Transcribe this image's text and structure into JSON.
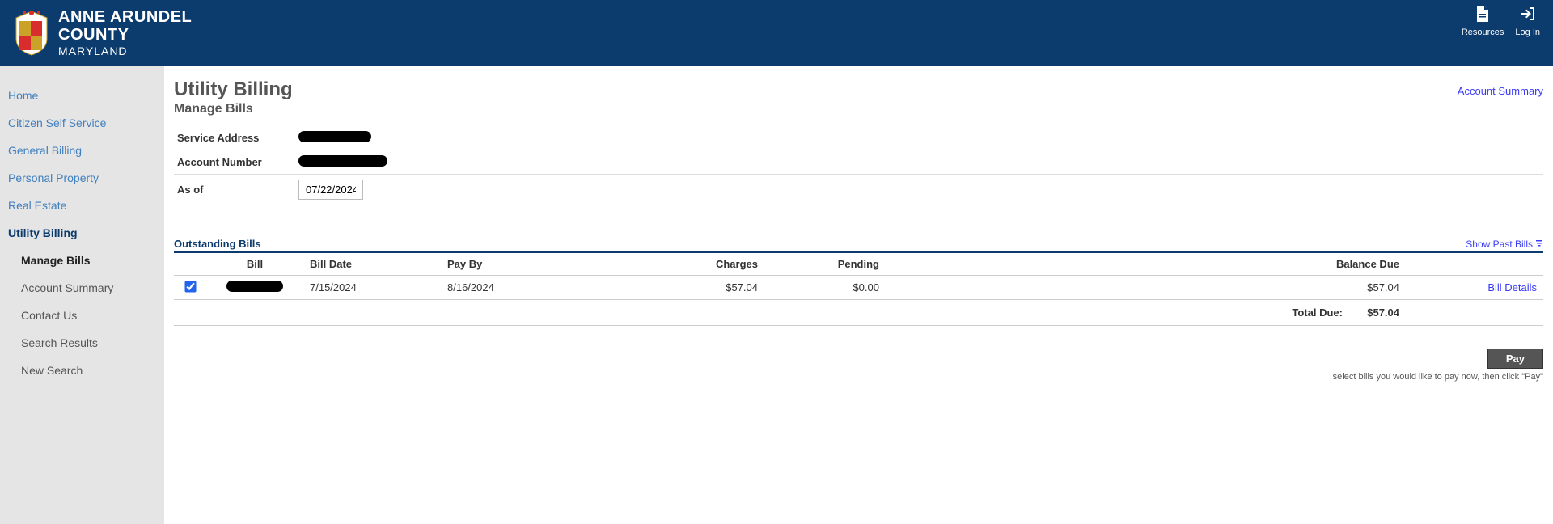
{
  "header": {
    "org_line1": "ANNE ARUNDEL",
    "org_line2": "COUNTY",
    "org_line3": "MARYLAND",
    "actions": {
      "resources": "Resources",
      "login": "Log In"
    }
  },
  "sidebar": {
    "items": [
      {
        "label": "Home"
      },
      {
        "label": "Citizen Self Service"
      },
      {
        "label": "General Billing"
      },
      {
        "label": "Personal Property"
      },
      {
        "label": "Real Estate"
      },
      {
        "label": "Utility Billing"
      }
    ],
    "subitems": [
      {
        "label": "Manage Bills"
      },
      {
        "label": "Account Summary"
      },
      {
        "label": "Contact Us"
      },
      {
        "label": "Search Results"
      },
      {
        "label": "New Search"
      }
    ]
  },
  "main": {
    "title": "Utility Billing",
    "subtitle": "Manage Bills",
    "account_summary_link": "Account Summary",
    "fields": {
      "service_address_label": "Service Address",
      "account_number_label": "Account Number",
      "as_of_label": "As of",
      "as_of_value": "07/22/2024"
    },
    "outstanding": {
      "title": "Outstanding Bills",
      "show_past": "Show Past Bills",
      "columns": {
        "bill": "Bill",
        "bill_date": "Bill Date",
        "pay_by": "Pay By",
        "charges": "Charges",
        "pending": "Pending",
        "balance_due": "Balance Due"
      },
      "rows": [
        {
          "checked": true,
          "bill_date": "7/15/2024",
          "pay_by": "8/16/2024",
          "charges": "$57.04",
          "pending": "$0.00",
          "balance_due": "$57.04",
          "details": "Bill Details"
        }
      ],
      "total_label": "Total Due:",
      "total_value": "$57.04"
    },
    "pay": {
      "button": "Pay",
      "hint": "select bills you would like to pay now, then click \"Pay\""
    }
  }
}
